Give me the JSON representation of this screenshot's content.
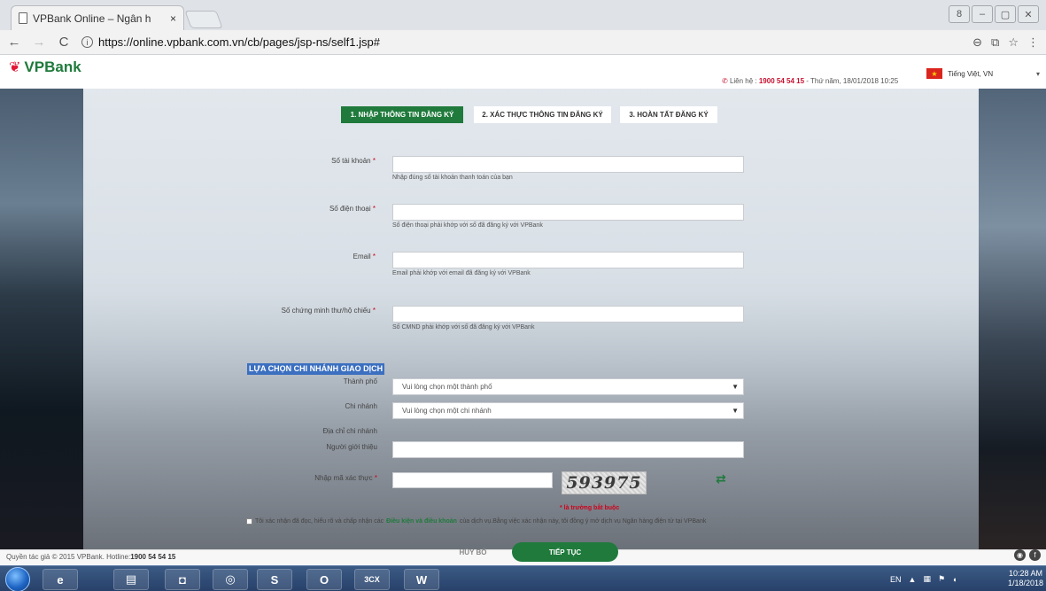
{
  "browser": {
    "tab_title": "VPBank Online – Ngân h",
    "tab_close": "×",
    "url": "https://online.vpbank.com.vn/cb/pages/jsp-ns/self1.jsp#",
    "back": "←",
    "forward": "→",
    "reload": "C",
    "info": "i",
    "zoom": "⊖",
    "translate": "⧉",
    "star": "☆",
    "menu": "⋮",
    "win_user": "8",
    "win_min": "–",
    "win_max": "▢",
    "win_close": "✕"
  },
  "header": {
    "logo_mark": "❦",
    "logo_text": "VPBank",
    "contact_label": "Liên hệ : ",
    "contact_phone": "1900 54 54 15",
    "contact_date": " - Thứ năm, 18/01/2018 10:25",
    "language": "Tiếng Việt, VN",
    "brand_color": "#1f7a3c"
  },
  "steps": [
    {
      "label": "1. NHẬP THÔNG TIN ĐĂNG KÝ"
    },
    {
      "label": "2. XÁC THỰC THÔNG TIN ĐĂNG KÝ"
    },
    {
      "label": "3. HOÀN TẤT ĐĂNG KÝ"
    }
  ],
  "form": {
    "account": {
      "label": "Số tài khoản",
      "help": "Nhập đúng số tài khoản thanh toán của bạn",
      "value": ""
    },
    "phone": {
      "label": "Số điện thoại",
      "help": "Số điện thoại phải khớp với số đã đăng ký với VPBank",
      "value": ""
    },
    "email": {
      "label": "Email",
      "help": "Email phải khớp với email đã đăng ký với VPBank",
      "value": ""
    },
    "idcard": {
      "label": "Số chứng minh thư/hộ chiếu",
      "help": "Số CMND phải khớp với số đã đăng ký với VPBank",
      "value": ""
    },
    "required_mark": "*",
    "branch_section": "LỰA CHỌN CHI NHÁNH GIAO DỊCH",
    "city": {
      "label": "Thành phố",
      "selected": "Vui lòng chọn một thành phố"
    },
    "branch": {
      "label": "Chi nhánh",
      "selected": "Vui lòng chọn một chi nhánh"
    },
    "branch_address_label": "Địa chỉ chi nhánh",
    "referrer_label": "Người giới thiệu",
    "captcha_label": "Nhập mã xác thực",
    "captcha_text": "593975",
    "refresh_icon": "⇄",
    "mandatory_note": "* là trường bắt buộc",
    "agree_prefix": "Tôi xác nhận đã đọc, hiểu rõ và chấp nhận các ",
    "agree_terms": "Điều kiện và điều khoản",
    "agree_suffix": " của dịch vụ.Bằng việc xác nhận này, tôi đồng ý mở dịch vụ Ngân hàng điện tử tại VPBank"
  },
  "footer": {
    "copyright": "Quyền tác giả © 2015 VPBank. Hotline:",
    "hotline": "1900 54 54 15",
    "cancel": "HỦY BỎ",
    "next": "TIẾP TỤC",
    "icon_a": "◉",
    "icon_b": "f"
  },
  "taskbar": {
    "apps": [
      "e",
      "▤",
      "◘",
      "◎",
      "S",
      "O",
      "3CX",
      "W"
    ],
    "lang": "EN",
    "time": "10:28 AM",
    "date": "1/18/2018"
  }
}
